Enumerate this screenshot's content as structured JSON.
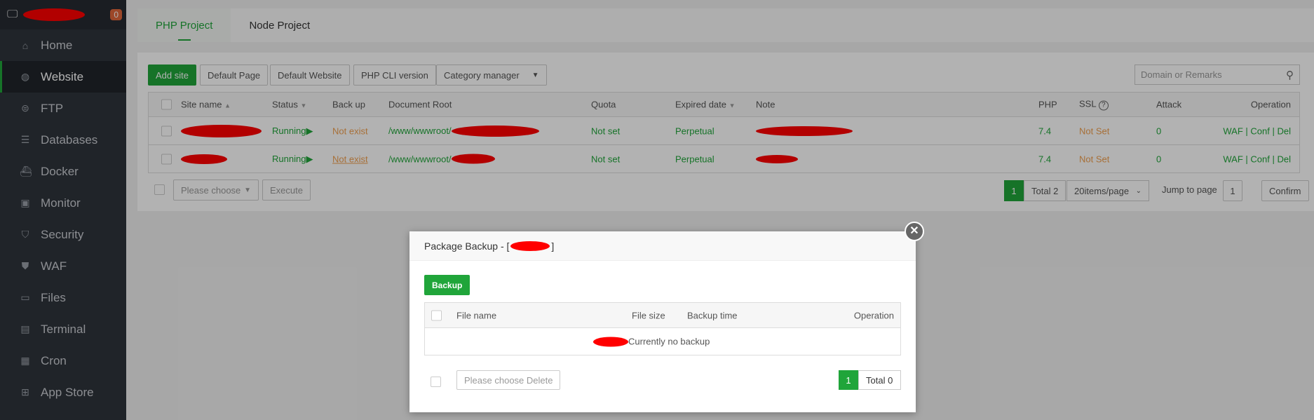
{
  "sidebar": {
    "badge": "0",
    "items": [
      {
        "label": "Home",
        "icon": "⌂"
      },
      {
        "label": "Website",
        "icon": "◍"
      },
      {
        "label": "FTP",
        "icon": "⊜"
      },
      {
        "label": "Databases",
        "icon": "☰"
      },
      {
        "label": "Docker",
        "icon": "⛴"
      },
      {
        "label": "Monitor",
        "icon": "▣"
      },
      {
        "label": "Security",
        "icon": "⛉"
      },
      {
        "label": "WAF",
        "icon": "⛊"
      },
      {
        "label": "Files",
        "icon": "▭"
      },
      {
        "label": "Terminal",
        "icon": "▤"
      },
      {
        "label": "Cron",
        "icon": "▦"
      },
      {
        "label": "App Store",
        "icon": "⊞"
      }
    ]
  },
  "tabs": [
    "PHP Project",
    "Node Project"
  ],
  "toolbar": {
    "add_site": "Add site",
    "default_page": "Default Page",
    "default_website": "Default Website",
    "php_cli": "PHP CLI version",
    "category": "Category manager",
    "search_placeholder": "Domain or Remarks"
  },
  "table": {
    "headers": {
      "site_name": "Site name",
      "status": "Status",
      "backup": "Back up",
      "root": "Document Root",
      "quota": "Quota",
      "expired": "Expired date",
      "note": "Note",
      "php": "PHP",
      "ssl": "SSL",
      "attack": "Attack",
      "operation": "Operation"
    },
    "rows": [
      {
        "status": "Running",
        "backup": "Not exist",
        "root": "/www/wwwroot/",
        "quota": "Not set",
        "expired": "Perpetual",
        "php": "7.4",
        "ssl": "Not Set",
        "attack": "0",
        "op_waf": "WAF",
        "op_conf": "Conf",
        "op_del": "Del"
      },
      {
        "status": "Running",
        "backup": "Not exist",
        "root": "/www/wwwroot/",
        "quota": "Not set",
        "expired": "Perpetual",
        "php": "7.4",
        "ssl": "Not Set",
        "attack": "0",
        "op_waf": "WAF",
        "op_conf": "Conf",
        "op_del": "Del"
      }
    ]
  },
  "footer": {
    "batch_placeholder": "Please choose",
    "execute": "Execute",
    "page": "1",
    "total": "Total 2",
    "per_page": "20items/page",
    "jump_label": "Jump to page",
    "jump_value": "1",
    "confirm": "Confirm"
  },
  "modal": {
    "title": "Package Backup - [",
    "title_end": "]",
    "backup_button": "Backup",
    "headers": {
      "file_name": "File name",
      "file_size": "File size",
      "backup_time": "Backup time",
      "operation": "Operation"
    },
    "empty": "Currently no backup",
    "delete_placeholder": "Please choose Delete",
    "page": "1",
    "total": "Total 0"
  }
}
